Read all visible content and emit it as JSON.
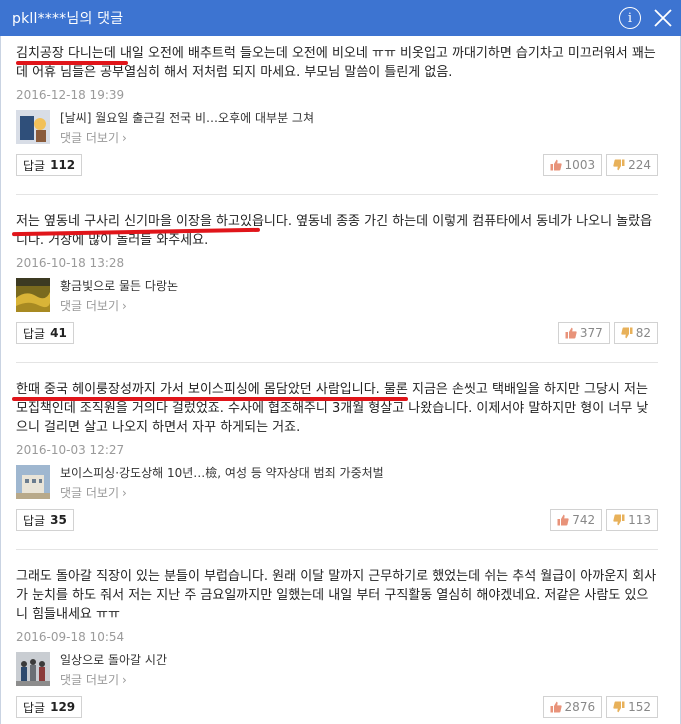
{
  "window": {
    "title": "pkll****님의 댓글"
  },
  "comments": [
    {
      "text": "김치공장 다니는데 내일 오전에 배추트럭 들오는데 오전에 비오네 ㅠㅠ 비옷입고 까대기하면 습기차고 미끄러워서 꽤는데 어휴 님들은 공부열심히 해서 저처럼 되지 마세요. 부모님 말씀이 틀린게 없음.",
      "date": "2016-12-18 19:39",
      "article": {
        "headline": "[날씨] 월요일 출근길 전국 비…오후에 대부분 그쳐",
        "more_label": "댓글 더보기"
      },
      "reply_label": "답글",
      "reply_count": "112",
      "likes": "1003",
      "dislikes": "224"
    },
    {
      "text": "저는 옆동네 구사리 신기마을 이장을 하고있읍니다. 옆동네 종종 가긴 하는데 이렇게 컴퓨타에서 동네가 나오니 놀랐읍니다. 거창에 많이 놀러들 와주세요.",
      "date": "2016-10-18 13:28",
      "article": {
        "headline": "황금빛으로 물든 다랑논",
        "more_label": "댓글 더보기"
      },
      "reply_label": "답글",
      "reply_count": "41",
      "likes": "377",
      "dislikes": "82"
    },
    {
      "text": "한때 중국 헤이룽장성까지 가서 보이스피싱에 몸담았던 사람입니다. 물론 지금은 손씻고 택배일을 하지만 그당시 저는 모집책인데 조직원을 거의다 걸렀었죠. 수사에 협조해주니 3개월 형살고 나왔습니다. 이제서야 말하지만 형이 너무 낮으니 걸리면 살고 나오지 하면서 자꾸 하게되는 거죠.",
      "date": "2016-10-03 12:27",
      "article": {
        "headline": "보이스피싱·강도상해 10년…檢, 여성 등 약자상대 범죄 가중처벌",
        "more_label": "댓글 더보기"
      },
      "reply_label": "답글",
      "reply_count": "35",
      "likes": "742",
      "dislikes": "113"
    },
    {
      "text": "그래도 돌아갈 직장이 있는 분들이 부럽습니다. 원래 이달 말까지 근무하기로 했었는데 쉬는 추석 월급이 아까운지 회사가 눈치를 하도 줘서 저는 지난 주 금요일까지만 일했는데 내일 부터 구직활동 열심히 해야겠네요. 저같은 사람도 있으니 힘들내세요 ㅠㅠ",
      "date": "2016-09-18 10:54",
      "article": {
        "headline": "일상으로 돌아갈 시간",
        "more_label": "댓글 더보기"
      },
      "reply_label": "답글",
      "reply_count": "129",
      "likes": "2876",
      "dislikes": "152"
    }
  ],
  "colors": {
    "titlebar": "#3d74d1",
    "annotation_underline": "#e0151a"
  },
  "icons": {
    "info": "info-icon",
    "close": "close-icon",
    "like": "thumbs-up-icon",
    "dislike": "thumbs-down-icon",
    "more": "chevron-right-icon"
  }
}
